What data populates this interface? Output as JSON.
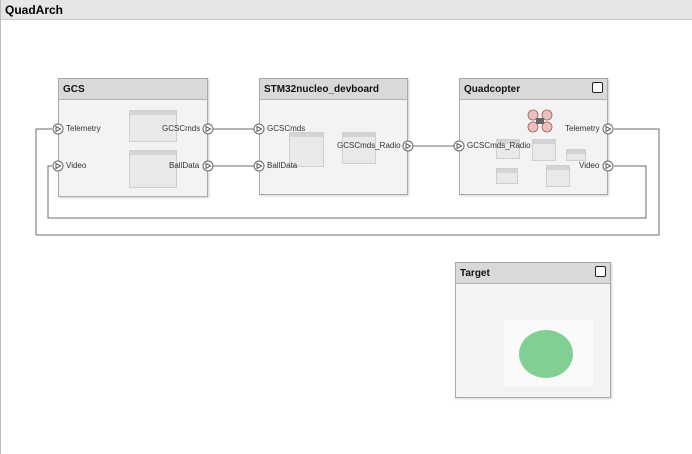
{
  "window": {
    "title": "QuadArch"
  },
  "blocks": {
    "gcs": {
      "title": "GCS",
      "ports": {
        "telemetry": "Telemetry",
        "video": "Video",
        "gcscmds": "GCSCmds",
        "balldata": "BallData"
      }
    },
    "stm32": {
      "title": "STM32nucleo_devboard",
      "ports": {
        "gcscmds": "GCSCmds",
        "balldata": "BallData",
        "gcscmds_radio": "GCSCmds_Radio"
      }
    },
    "quad": {
      "title": "Quadcopter",
      "ports": {
        "gcscmds_radio": "GCSCmds_Radio",
        "telemetry": "Telemetry",
        "video": "Video"
      }
    },
    "target": {
      "title": "Target"
    }
  },
  "colors": {
    "wire": "#6e6e6e",
    "block_fill": "#f3f3f3",
    "header_fill": "#d9d9d9",
    "target_circle": "#81cf93"
  }
}
